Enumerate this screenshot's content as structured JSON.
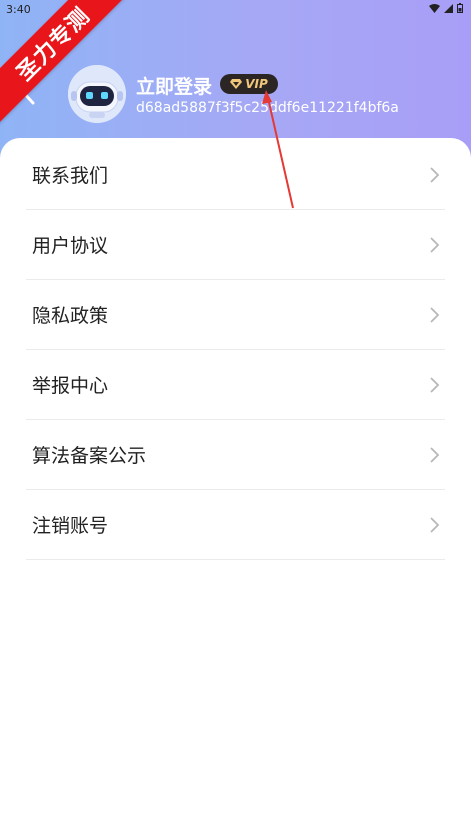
{
  "status_bar": {
    "time": "3:40"
  },
  "ribbon": {
    "text": "圣力专测"
  },
  "profile": {
    "login_label": "立即登录",
    "vip_label": "VIP",
    "user_id": "d68ad5887f3f5c25ddf6e11221f4bf6a"
  },
  "menu": {
    "items": [
      {
        "label": "联系我们"
      },
      {
        "label": "用户协议"
      },
      {
        "label": "隐私政策"
      },
      {
        "label": "举报中心"
      },
      {
        "label": "算法备案公示"
      },
      {
        "label": "注销账号"
      }
    ]
  },
  "colors": {
    "header_start": "#8fb4f6",
    "header_end": "#a89ef7",
    "ribbon": "#e8161b",
    "vip_bg": "#2b2624",
    "vip_text": "#f1c77b",
    "annotation_arrow": "#e53935"
  }
}
